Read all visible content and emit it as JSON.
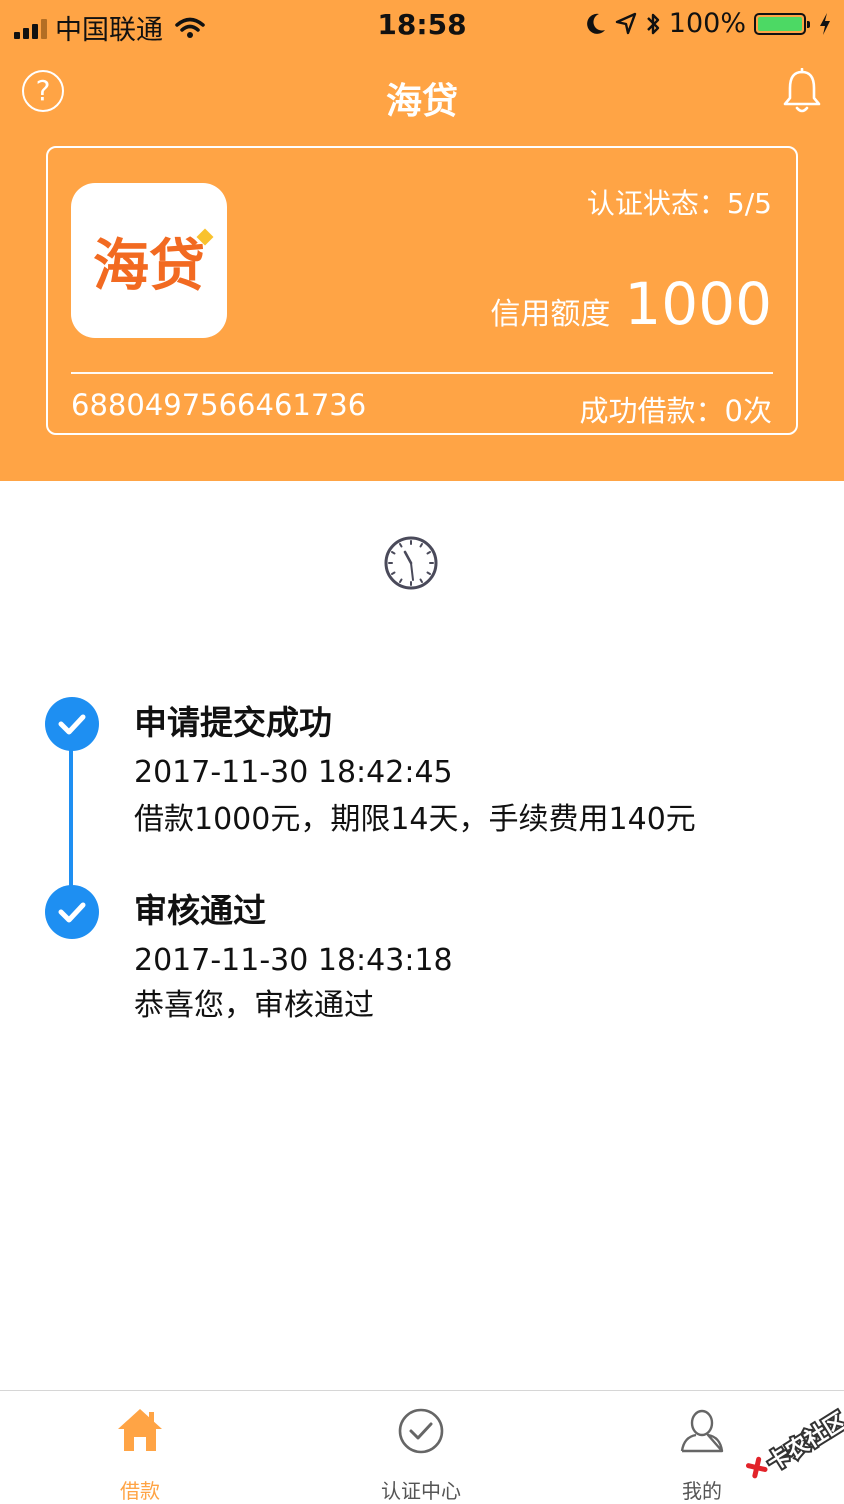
{
  "status_bar": {
    "carrier": "中国联通",
    "time": "18:58",
    "battery": "100%"
  },
  "header": {
    "title": "海贷",
    "help_icon": "question-circle-icon",
    "notification_icon": "bell-icon"
  },
  "card": {
    "logo_text": "海贷",
    "cert_status": "认证状态：5/5",
    "credit_label": "信用额度",
    "credit_value": "1000",
    "card_number": "6880497566461736",
    "success_count": "成功借款：0次"
  },
  "timeline": {
    "icon": "clock-icon",
    "steps": [
      {
        "title": "申请提交成功",
        "time": "2017-11-30 18:42:45",
        "desc": "借款1000元，期限14天，手续费用140元"
      },
      {
        "title": "审核通过",
        "time": "2017-11-30 18:43:18",
        "desc": "恭喜您，审核通过"
      }
    ]
  },
  "tabbar": {
    "active_color": "#FFA445",
    "tabs": [
      {
        "label": "借款",
        "icon": "home-icon",
        "active": true
      },
      {
        "label": "认证中心",
        "icon": "check-circle-icon",
        "active": false
      },
      {
        "label": "我的",
        "icon": "user-icon",
        "active": false
      }
    ]
  },
  "watermark": {
    "text": "卡农社区"
  },
  "colors": {
    "brand_orange": "#FFA445",
    "timeline_blue": "#1E8FF2"
  }
}
